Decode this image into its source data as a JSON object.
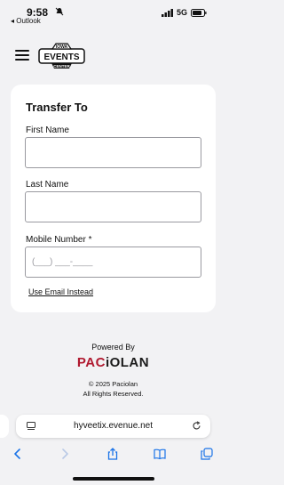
{
  "status_bar": {
    "time": "9:58",
    "back_app": "◂ Outlook",
    "network": "5G"
  },
  "header": {
    "menu_icon": "hamburger-menu-icon",
    "logo": {
      "line1": "IOWA",
      "line2": "EVENTS",
      "line3": "CENTER"
    }
  },
  "form": {
    "title": "Transfer To",
    "first_name": {
      "label": "First Name",
      "value": "",
      "placeholder": ""
    },
    "last_name": {
      "label": "Last Name",
      "value": "",
      "placeholder": ""
    },
    "mobile": {
      "label": "Mobile Number *",
      "value": "",
      "placeholder": "(___) ___-____"
    },
    "email_link": "Use Email Instead"
  },
  "footer": {
    "powered_by": "Powered By",
    "brand_pac": "PAC",
    "brand_rest": "iOLAN",
    "copyright": "© 2025 Paciolan",
    "rights": "All Rights Reserved."
  },
  "browser": {
    "url": "hyveetix.evenue.net",
    "toolbar": [
      "back-icon",
      "forward-icon",
      "share-icon",
      "bookmarks-icon",
      "tabs-icon"
    ]
  },
  "colors": {
    "accent_blue": "#1a73e8",
    "brand_red": "#b0192f",
    "background": "#f2f2f4"
  }
}
